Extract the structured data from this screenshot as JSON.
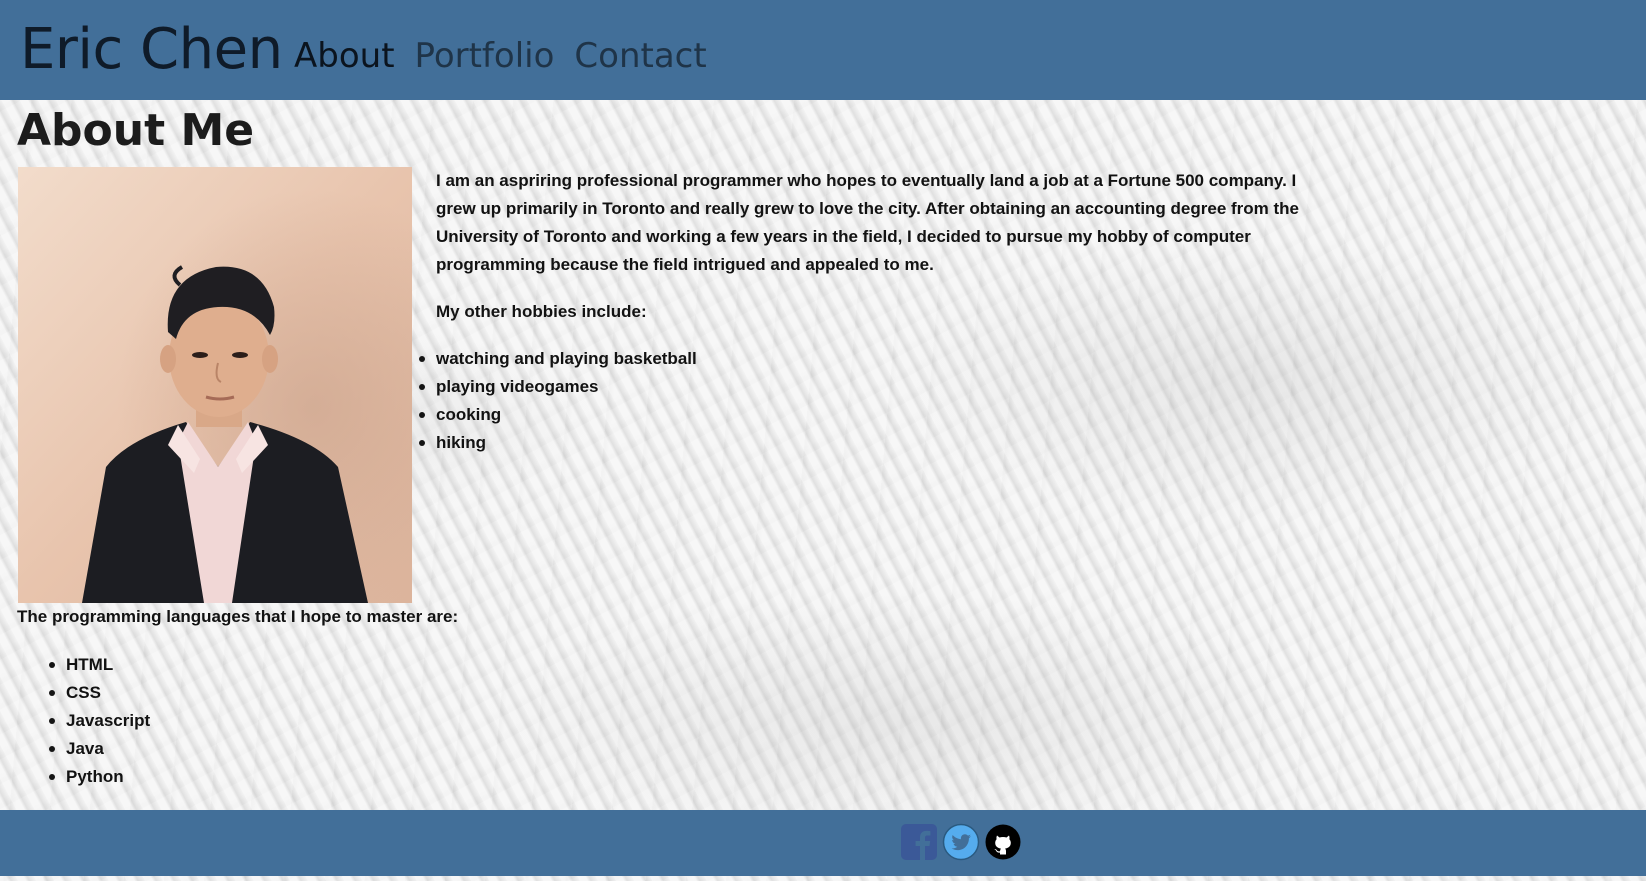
{
  "header": {
    "brand": "Eric Chen",
    "nav": [
      {
        "label": "About"
      },
      {
        "label": "Portfolio"
      },
      {
        "label": "Contact"
      }
    ]
  },
  "main": {
    "title": "About Me",
    "intro": "I am an aspriring professional programmer who hopes to eventually land a job at a Fortune 500 company. I grew up primarily in Toronto and really grew to love the city. After obtaining an accounting degree from the University of Toronto and working a few years in the field, I decided to pursue my hobby of computer programming because the field intrigued and appealed to me.",
    "hobbies_lead": "My other hobbies include:",
    "hobbies": [
      "watching and playing basketball",
      "playing videogames",
      "cooking",
      "hiking"
    ],
    "languages_lead": "The programming languages that I hope to master are:",
    "languages": [
      "HTML",
      "CSS",
      "Javascript",
      "Java",
      "Python"
    ]
  },
  "footer": {
    "social": [
      {
        "icon": "facebook-icon",
        "color": "#3b5998"
      },
      {
        "icon": "twitter-icon",
        "color": "#55acee"
      },
      {
        "icon": "github-icon",
        "color": "#000000"
      }
    ]
  },
  "colors": {
    "header_bg": "#426f99",
    "footer_bg": "#426f99",
    "text": "#121212"
  }
}
